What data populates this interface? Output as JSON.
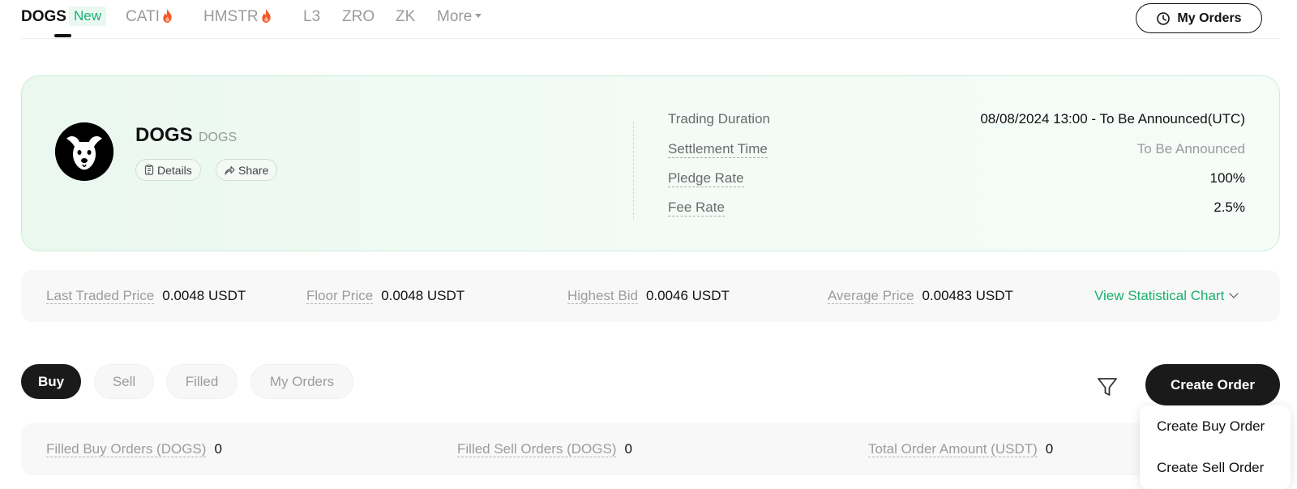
{
  "top_tabs": {
    "items": [
      {
        "label": "DOGS",
        "badge": "New"
      },
      {
        "label": "CATI",
        "hot": true
      },
      {
        "label": "HMSTR",
        "hot": true
      },
      {
        "label": "L3"
      },
      {
        "label": "ZRO"
      },
      {
        "label": "ZK"
      },
      {
        "label": "More"
      }
    ],
    "my_orders_label": "My Orders"
  },
  "token": {
    "name": "DOGS",
    "symbol": "DOGS",
    "details_label": "Details",
    "share_label": "Share"
  },
  "info": {
    "trading_duration_label": "Trading Duration",
    "trading_duration_value": "08/08/2024 13:00 - To Be Announced(UTC)",
    "settlement_time_label": "Settlement Time",
    "settlement_time_value": "To Be Announced",
    "pledge_rate_label": "Pledge Rate",
    "pledge_rate_value": "100%",
    "fee_rate_label": "Fee Rate",
    "fee_rate_value": "2.5%"
  },
  "prices": {
    "last_traded_label": "Last Traded Price",
    "last_traded_value": "0.0048 USDT",
    "floor_label": "Floor Price",
    "floor_value": "0.0048 USDT",
    "highest_bid_label": "Highest Bid",
    "highest_bid_value": "0.0046 USDT",
    "average_label": "Average Price",
    "average_value": "0.00483 USDT",
    "view_chart_label": "View Statistical Chart"
  },
  "order_tabs": [
    "Buy",
    "Sell",
    "Filled",
    "My Orders"
  ],
  "create_order_label": "Create Order",
  "create_menu": [
    "Create Buy Order",
    "Create Sell Order"
  ],
  "filled": {
    "buy_label": "Filled Buy Orders (DOGS)",
    "buy_value": "0",
    "sell_label": "Filled Sell Orders (DOGS)",
    "sell_value": "0",
    "total_label": "Total Order Amount (USDT)",
    "total_value": "0"
  },
  "colors": {
    "accent_green": "#19b06f",
    "card_bg": "#eaf8f0",
    "dark_button": "#1a1a1a",
    "hot_orange": "#f25a2a"
  }
}
